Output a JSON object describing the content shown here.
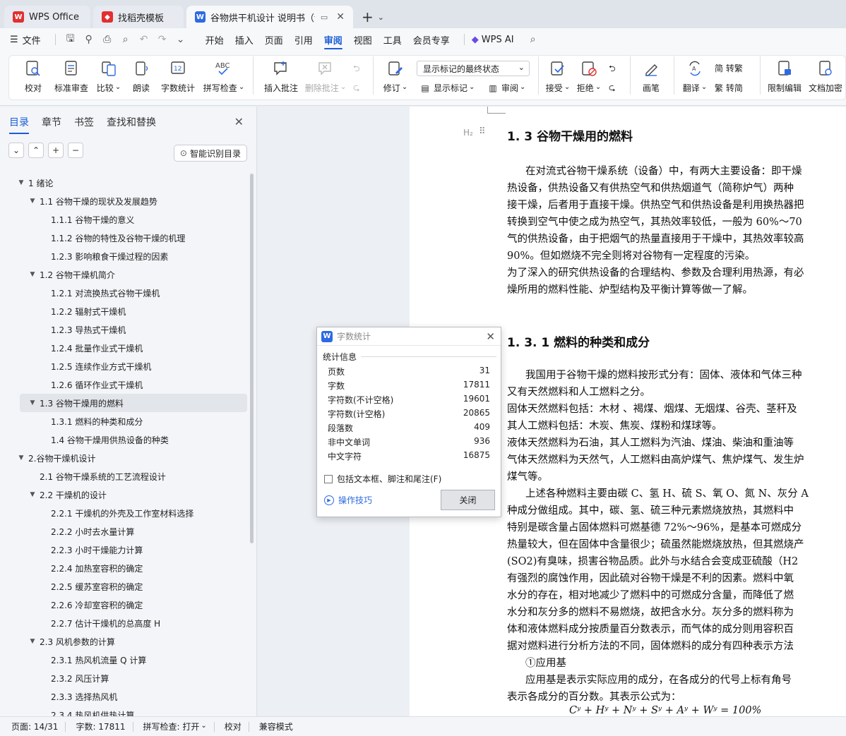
{
  "tabs": [
    {
      "label": "WPS Office",
      "icon": "wps-logo-icon",
      "color": "#e0302f"
    },
    {
      "label": "找稻壳模板",
      "icon": "docer-icon",
      "color": "#e0302f"
    },
    {
      "label": "谷物烘干机设计 说明书（论文",
      "icon": "word-doc-icon",
      "color": "#2d6ae3"
    }
  ],
  "menu": {
    "file": "文件",
    "items": [
      "开始",
      "插入",
      "页面",
      "引用",
      "审阅",
      "视图",
      "工具",
      "会员专享"
    ],
    "active": "审阅",
    "ai": "WPS AI"
  },
  "ribbon": {
    "proofread": "校对",
    "std_review": "标准审查",
    "compare": "比较",
    "read_aloud": "朗读",
    "word_count": "字数统计",
    "spell_check": "拼写检查",
    "insert_comment": "插入批注",
    "delete_comment": "删除批注",
    "revise": "修订",
    "markup_select": "显示标记的最终状态",
    "show_markup": "显示标记",
    "review": "审阅",
    "accept": "接受",
    "reject": "拒绝",
    "pen": "画笔",
    "translate": "翻译",
    "to_traditional": "简 转繁",
    "to_simplified": "繁 转简",
    "restrict_edit": "限制编辑",
    "doc_encrypt": "文档加密"
  },
  "nav": {
    "tabs": [
      "目录",
      "章节",
      "书签",
      "查找和替换"
    ],
    "active_tab": "目录",
    "smart_btn": "智能识别目录",
    "toc": [
      {
        "label": "1 绪论",
        "level": 0,
        "caret": true
      },
      {
        "label": "1.1 谷物干燥的现状及发展趋势",
        "level": 1,
        "caret": true
      },
      {
        "label": "1.1.1 谷物干燥的意义",
        "level": 2
      },
      {
        "label": "1.1.2 谷物的特性及谷物干燥的机理",
        "level": 2
      },
      {
        "label": "1.2.3 影响粮食干燥过程的因素",
        "level": 2
      },
      {
        "label": "1.2  谷物干燥机简介",
        "level": 1,
        "caret": true
      },
      {
        "label": "1.2.1 对流换热式谷物干燥机",
        "level": 2
      },
      {
        "label": "1.2.2 辐射式干燥机",
        "level": 2
      },
      {
        "label": "1.2.3 导热式干燥机",
        "level": 2
      },
      {
        "label": "1.2.4 批量作业式干燥机",
        "level": 2
      },
      {
        "label": "1.2.5 连续作业方式干燥机",
        "level": 2
      },
      {
        "label": "1.2.6  循环作业式干燥机",
        "level": 2
      },
      {
        "label": "1.3  谷物干燥用的燃料",
        "level": 1,
        "caret": true,
        "selected": true
      },
      {
        "label": "1.3.1 燃料的种类和成分",
        "level": 2
      },
      {
        "label": "1.4  谷物干燥用供热设备的种类",
        "level": 2
      },
      {
        "label": "2.谷物干燥机设计",
        "level": 0,
        "caret": true
      },
      {
        "label": "2.1 谷物干燥系统的工艺流程设计",
        "level": 1
      },
      {
        "label": "2.2 干燥机的设计",
        "level": 1,
        "caret": true
      },
      {
        "label": "2.2.1  干燥机的外壳及工作室材料选择",
        "level": 2
      },
      {
        "label": "2.2.2  小时去水量计算",
        "level": 2
      },
      {
        "label": "2.2.3  小时干燥能力计算",
        "level": 2
      },
      {
        "label": "2.2.4  加热室容积的确定",
        "level": 2
      },
      {
        "label": "2.2.5  缓苏室容积的确定",
        "level": 2
      },
      {
        "label": "2.2.6  冷却室容积的确定",
        "level": 2
      },
      {
        "label": "2.2.7 估计干燥机的总高度 H",
        "level": 2
      },
      {
        "label": "2.3 风机参数的计算",
        "level": 1,
        "caret": true
      },
      {
        "label": "2.3.1 热风机流量 Q 计算",
        "level": 2
      },
      {
        "label": "2.3.2  风压计算",
        "level": 2
      },
      {
        "label": "2.3.3   选择热风机",
        "level": 2
      },
      {
        "label": "2.3.4  热风机供热计算",
        "level": 2
      }
    ]
  },
  "doc": {
    "heading_marker": "H₂",
    "h1": "1. 3  谷物干燥用的燃料",
    "p1": [
      "在对流式谷物干燥系统（设备）中，有两大主要设备：即干燥",
      "热设备，供热设备又有供热空气和供热烟道气（简称炉气）两种",
      "接干燥，后者用于直接干燥。供热空气和供热设备是利用换热器把",
      "转换到空气中使之成为热空气，其热效率较低，一般为 60%～70",
      "气的供热设备，由于把烟气的热量直接用于干燥中，其热效率较高",
      "90%。但如燃烧不完全则将对谷物有一定程度的污染。",
      "为了深入的研究供热设备的合理结构、参数及合理利用热源，有必",
      "燥所用的燃料性能、炉型结构及平衡计算等做一了解。"
    ],
    "h2": "1. 3. 1 燃料的种类和成分",
    "p2": [
      "我国用于谷物干燥的燃料按形式分有：固体、液体和气体三种",
      "又有天然燃料和人工燃料之分。",
      "固体天然燃料包括：木材 、褐煤、烟煤、无烟煤、谷壳、茎秆及",
      "其人工燃料包括：木炭、焦炭、煤粉和煤球等。",
      "液体天然燃料为石油，其人工燃料为汽油、煤油、柴油和重油等",
      "气体天然燃料为天然气，人工燃料由高炉煤气、焦炉煤气、发生炉",
      "煤气等。",
      "上述各种燃料主要由碳 C、氢 H、硫 S、氧 O、氮 N、灰分 A",
      "种成分做组成。其中，碳、氢、硫三种元素燃烧放热，其燃料中",
      "特别是碳含量占固体燃料可燃基德 72%～96%，是基本可燃成分",
      "热量较大，但在固体中含量很少；硫虽然能燃烧放热，但其燃烧产",
      "(SO2)有臭味，损害谷物品质。此外与水结合会变成亚硫酸（H2",
      "有强烈的腐蚀作用，因此硫对谷物干燥是不利的因素。燃料中氧",
      "水分的存在，相对地减少了燃料中的可燃成分含量，而降低了燃",
      "水分和灰分多的燃料不易燃烧，故把含水分。灰分多的燃料称为",
      "体和液体燃料成分按质量百分数表示，而气体的成分则用容积百",
      "据对燃料进行分析方法的不同，固体燃料的成分有四种表示方法",
      "①应用基",
      "应用基是表示实际应用的成分，在各成分的代号上标有角号",
      "表示各成分的百分数。其表示公式为："
    ],
    "formula": "Cʸ + Hʸ + Nʸ + Sʸ + Aʸ + Wʸ = 100%"
  },
  "dialog": {
    "title": "字数统计",
    "section": "统计信息",
    "stats": [
      {
        "label": "页数",
        "value": "31"
      },
      {
        "label": "字数",
        "value": "17811"
      },
      {
        "label": "字符数(不计空格)",
        "value": "19601"
      },
      {
        "label": "字符数(计空格)",
        "value": "20865"
      },
      {
        "label": "段落数",
        "value": "409"
      },
      {
        "label": "非中文单词",
        "value": "936"
      },
      {
        "label": "中文字符",
        "value": "16875"
      }
    ],
    "checkbox": "包括文本框、脚注和尾注(F)",
    "tips": "操作技巧",
    "close_btn": "关闭"
  },
  "status": {
    "page": "页面: 14/31",
    "words": "字数: 17811",
    "spell": "拼写检查: 打开",
    "proof": "校对",
    "compat": "兼容模式"
  }
}
